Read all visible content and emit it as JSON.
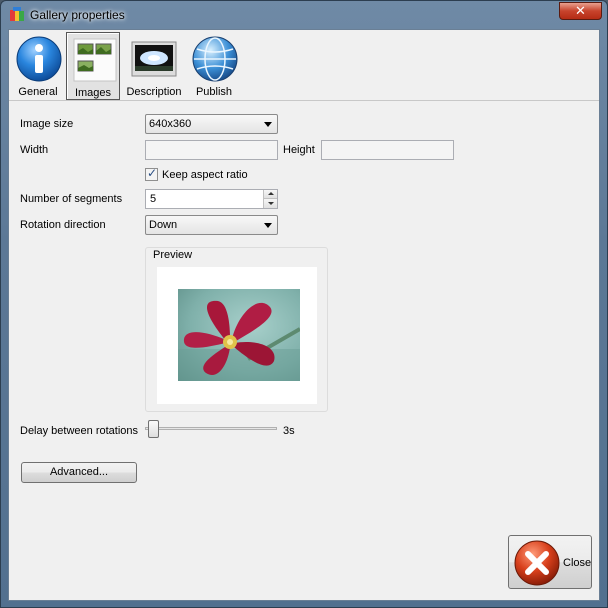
{
  "window": {
    "title": "Gallery properties",
    "close_glyph": "✕"
  },
  "toolbar": {
    "items": [
      {
        "label": "General",
        "icon": "info-icon",
        "selected": false
      },
      {
        "label": "Images",
        "icon": "images-icon",
        "selected": true
      },
      {
        "label": "Description",
        "icon": "description-icon",
        "selected": false
      },
      {
        "label": "Publish",
        "icon": "globe-icon",
        "selected": false
      }
    ]
  },
  "form": {
    "image_size_label": "Image size",
    "image_size_value": "640x360",
    "width_label": "Width",
    "width_value": "",
    "height_label": "Height",
    "height_value": "",
    "keep_aspect_label": "Keep aspect ratio",
    "keep_aspect_checked": true,
    "segments_label": "Number of segments",
    "segments_value": "5",
    "rotation_label": "Rotation direction",
    "rotation_value": "Down",
    "preview_label": "Preview",
    "delay_label": "Delay between rotations",
    "delay_value": "3s",
    "delay_fraction": 0.0
  },
  "buttons": {
    "advanced_label": "Advanced...",
    "close_label": "Close"
  },
  "colors": {
    "info_blue": "#1f7fd6",
    "close_red": "#c8381b"
  }
}
